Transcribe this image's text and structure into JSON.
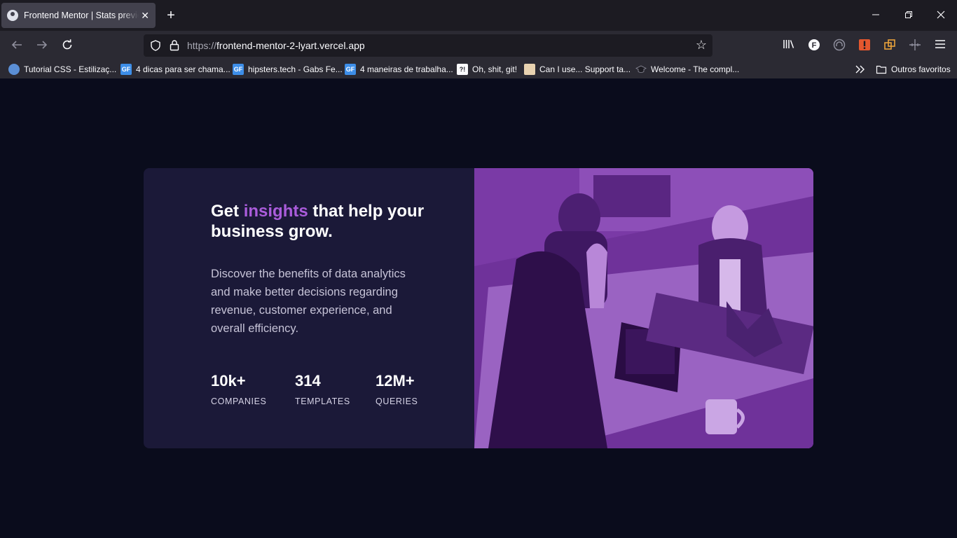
{
  "browser": {
    "tab_title": "Frontend Mentor | Stats preview card component",
    "new_tab": "+",
    "url_scheme": "https://",
    "url_host": "frontend-mentor-2-lyart.vercel.app",
    "bookmarks": [
      {
        "label": "Tutorial CSS - Estilizaç...",
        "icon": "globe-icon"
      },
      {
        "label": "4 dicas para ser chama...",
        "icon": "GF"
      },
      {
        "label": "hipsters.tech - Gabs Fe...",
        "icon": "GF"
      },
      {
        "label": "4 maneiras de trabalha...",
        "icon": "GF"
      },
      {
        "label": "Oh, shit, git!",
        "icon": "?!"
      },
      {
        "label": "Can I use... Support ta...",
        "icon": "caniuse-icon"
      },
      {
        "label": "Welcome - The compl...",
        "icon": "graduation-cap-icon"
      }
    ],
    "other_bookmarks": "Outros favoritos"
  },
  "card": {
    "headline_pre": "Get ",
    "headline_accent": "insights",
    "headline_post": " that help your business grow.",
    "description": "Discover the benefits of data analytics and make better decisions regarding revenue, customer experience, and overall efficiency.",
    "stats": [
      {
        "value": "10k+",
        "label": "COMPANIES"
      },
      {
        "value": "314",
        "label": "TEMPLATES"
      },
      {
        "value": "12M+",
        "label": "QUERIES"
      }
    ]
  },
  "colors": {
    "page_bg": "#0a0c1c",
    "card_bg": "#1b1938",
    "accent": "#aa5cdb",
    "image_tint": "#7b3aa8"
  }
}
